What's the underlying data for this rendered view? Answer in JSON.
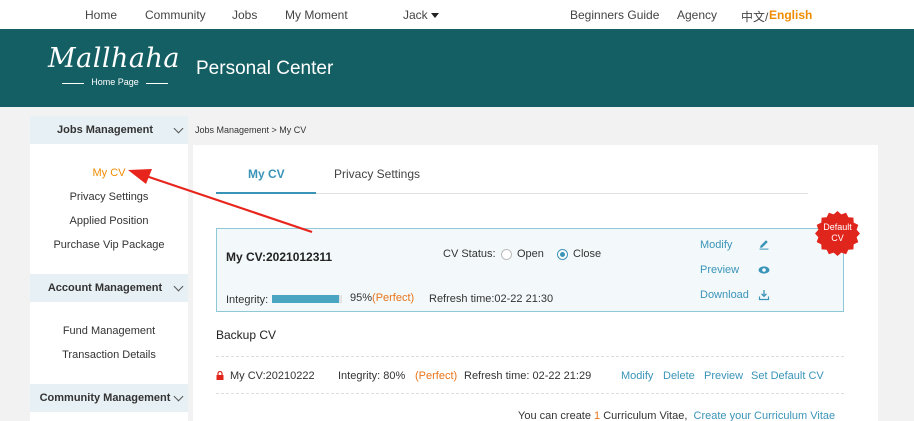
{
  "topnav": {
    "home": "Home",
    "community": "Community",
    "jobs": "Jobs",
    "moment": "My Moment",
    "user": "Jack",
    "guide": "Beginners Guide",
    "agency": "Agency",
    "lang_zh": "中文/",
    "lang_en": "English"
  },
  "header": {
    "logo": "Mallhaha",
    "logo_sub": "Home Page",
    "title": "Personal Center"
  },
  "sidebar": {
    "jobs_head": "Jobs Management",
    "jobs_items": [
      "My CV",
      "Privacy Settings",
      "Applied Position",
      "Purchase Vip Package"
    ],
    "account_head": "Account Management",
    "account_items": [
      "Fund Management",
      "Transaction Details"
    ],
    "community_head": "Community Management"
  },
  "breadcrumb": "Jobs Management > My CV",
  "tabs": [
    "My CV",
    "Privacy Settings"
  ],
  "cv": {
    "title": "My CV:2021012311",
    "status_label": "CV Status:",
    "open": "Open",
    "close": "Close",
    "selected": "Close",
    "integrity_label": "Integrity:",
    "integrity_pct": "95%",
    "integrity_fraction": 0.95,
    "perfect": "(Perfect)",
    "refresh": "Refresh time:02-22 21:30",
    "actions": [
      "Modify",
      "Preview",
      "Download"
    ]
  },
  "badge": {
    "line1": "Default",
    "line2": "CV"
  },
  "backup": {
    "title": "Backup CV",
    "name": "My CV:20210222",
    "integrity": "Integrity:  80%",
    "perfect": "(Perfect)",
    "refresh": "Refresh time:  02-22 21:29",
    "actions": [
      "Modify",
      "Delete",
      "Preview",
      "Set Default CV"
    ]
  },
  "footer": {
    "prefix": "You can create",
    "count": "1",
    "suffix": "Curriculum Vitae",
    "link": "Create your Curriculum Vitae"
  },
  "colors": {
    "header_bg": "#145f64",
    "accent": "#3a94b8",
    "orange": "#f08c00",
    "badge": "#e0251c"
  }
}
